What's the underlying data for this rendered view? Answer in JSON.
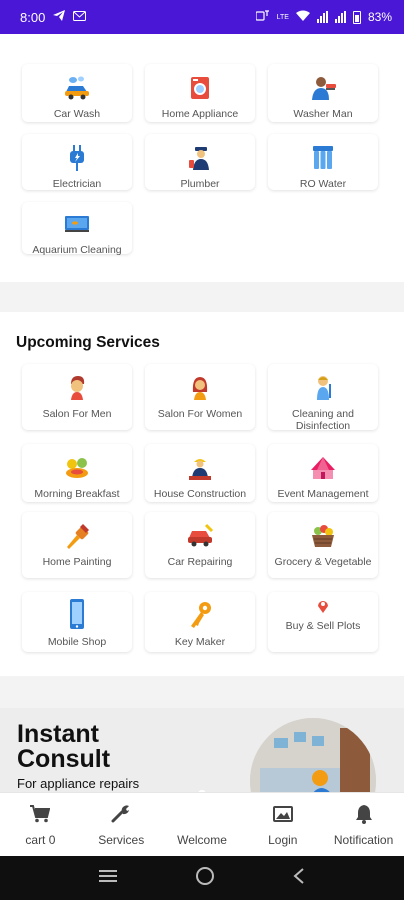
{
  "statusbar": {
    "time": "8:00",
    "network_label": "LTE",
    "battery": "83%",
    "icons": [
      "telegram-icon",
      "mail-icon",
      "volte-icon",
      "wifi-icon",
      "signal-icon",
      "battery-icon"
    ]
  },
  "services": [
    {
      "label": "Car Wash",
      "icon": "car-wash-icon"
    },
    {
      "label": "Home Appliance",
      "icon": "home-appliance-icon"
    },
    {
      "label": "Washer Man",
      "icon": "washer-man-icon"
    },
    {
      "label": "Electrician",
      "icon": "plug-icon"
    },
    {
      "label": "Plumber",
      "icon": "plumber-icon"
    },
    {
      "label": "RO Water",
      "icon": "water-filter-icon"
    },
    {
      "label": "Aquarium Cleaning",
      "icon": "aquarium-icon"
    }
  ],
  "upcoming": {
    "title": "Upcoming Services",
    "items": [
      {
        "label": "Salon For Men",
        "icon": "salon-men-icon"
      },
      {
        "label": "Salon For Women",
        "icon": "salon-women-icon"
      },
      {
        "label": "Cleaning and Disinfection",
        "icon": "cleaning-icon"
      },
      {
        "label": "Morning Breakfast",
        "icon": "breakfast-icon"
      },
      {
        "label": "House Construction",
        "icon": "construction-icon"
      },
      {
        "label": "Event Management",
        "icon": "tent-icon"
      },
      {
        "label": "Home Painting",
        "icon": "paint-brush-icon"
      },
      {
        "label": "Car Repairing",
        "icon": "car-repair-icon"
      },
      {
        "label": "Grocery & Vegetable",
        "icon": "grocery-basket-icon"
      },
      {
        "label": "Mobile Shop",
        "icon": "mobile-icon"
      },
      {
        "label": "Key Maker",
        "icon": "key-icon"
      },
      {
        "label": "Buy & Sell Plots",
        "icon": "map-pin-icon"
      }
    ]
  },
  "banner": {
    "line1": "Instant",
    "line2": "Consult",
    "sub": "For appliance repairs"
  },
  "bottomnav": {
    "cart": "cart 0",
    "services": "Services",
    "welcome": "Welcome",
    "login": "Login",
    "notification": "Notification"
  },
  "colors": {
    "statusbar": "#4a17d6",
    "accent_orange": "#f39c12",
    "accent_blue": "#2b7bd4",
    "nav_icon": "#444444"
  }
}
